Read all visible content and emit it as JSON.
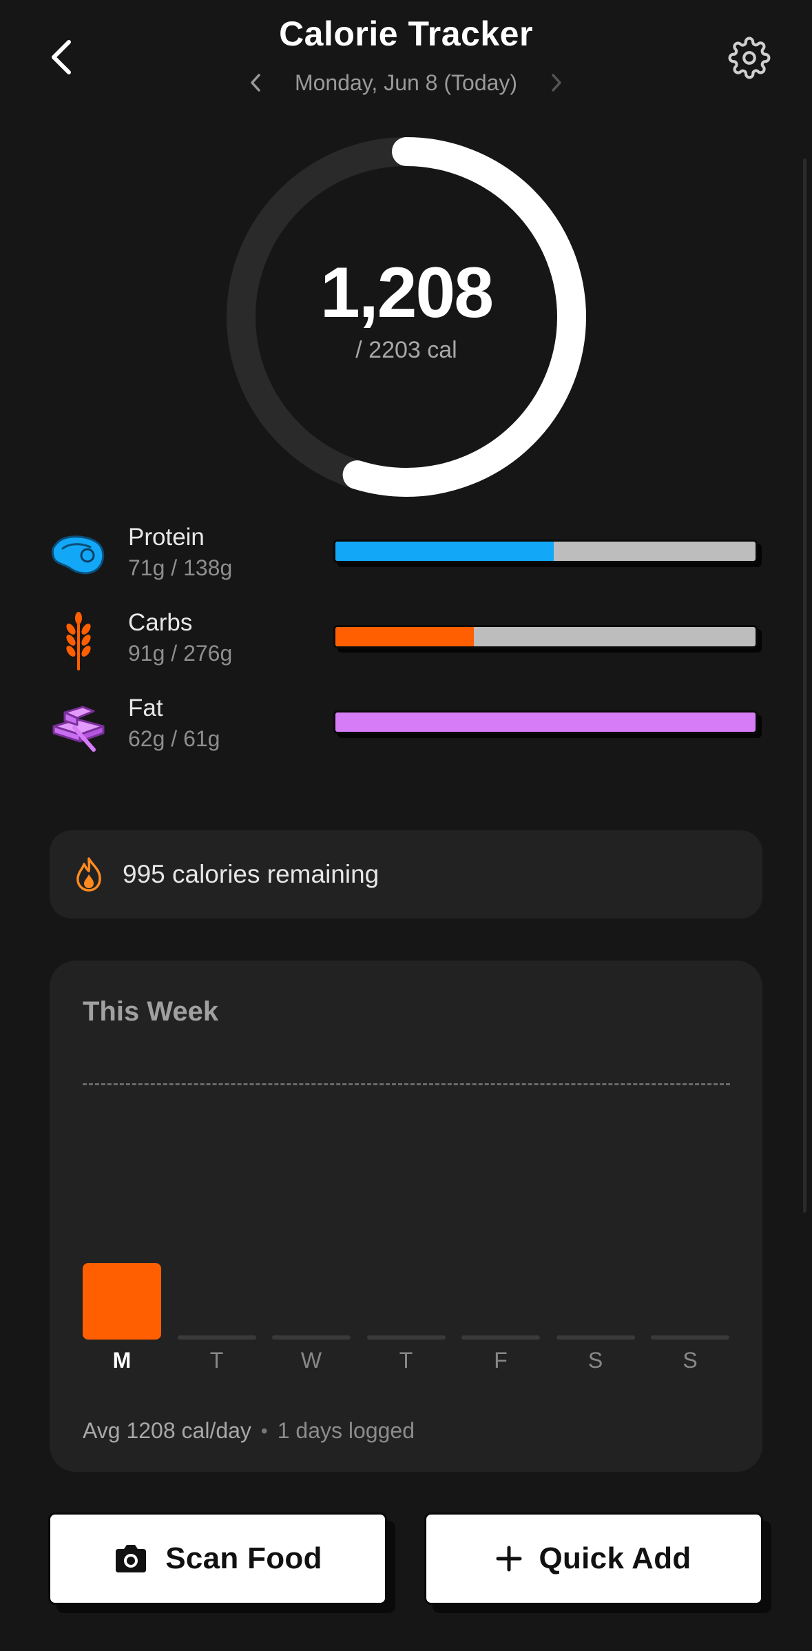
{
  "header": {
    "title": "Calorie Tracker",
    "date": "Monday, Jun 8 (Today)"
  },
  "ring": {
    "consumed": "1,208",
    "goal_text": "/ 2203 cal",
    "progress": 0.548,
    "track_color": "#2a2a2a",
    "fill_color": "#ffffff"
  },
  "macros": [
    {
      "name": "Protein",
      "amount": "71g / 138g",
      "progress": 0.52,
      "color": "#13a8f7",
      "icon": "steak-icon"
    },
    {
      "name": "Carbs",
      "amount": "91g / 276g",
      "progress": 0.33,
      "color": "#ff5f00",
      "icon": "wheat-icon"
    },
    {
      "name": "Fat",
      "amount": "62g / 61g",
      "progress": 1.0,
      "color": "#d57cf6",
      "icon": "butter-icon"
    }
  ],
  "remaining": {
    "text": "995 calories remaining",
    "icon": "flame-icon",
    "icon_color": "#ff8a1f"
  },
  "week": {
    "title": "This Week",
    "days": [
      {
        "label": "M",
        "calories": 1208,
        "active": true
      },
      {
        "label": "T",
        "calories": 0,
        "active": false
      },
      {
        "label": "W",
        "calories": 0,
        "active": false
      },
      {
        "label": "T",
        "calories": 0,
        "active": false
      },
      {
        "label": "F",
        "calories": 0,
        "active": false
      },
      {
        "label": "S",
        "calories": 0,
        "active": false
      },
      {
        "label": "S",
        "calories": 0,
        "active": false
      }
    ],
    "goal": 2203,
    "bar_color": "#ff5f00",
    "empty_color": "#3a3a3a",
    "avg_text": "Avg 1208 cal/day",
    "logged_text": "1 days logged"
  },
  "actions": {
    "scan_label": "Scan Food",
    "quick_add_label": "Quick Add"
  }
}
